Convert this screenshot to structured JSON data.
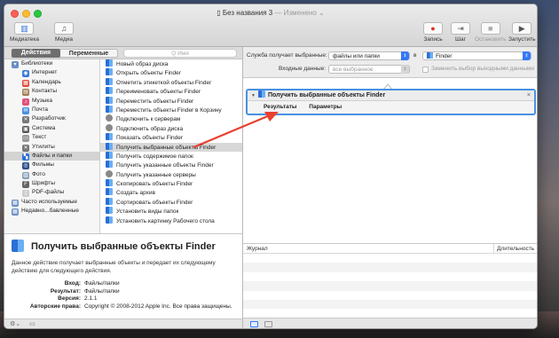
{
  "window": {
    "title": "Без названия 3",
    "title_suffix": " — Изменено ⌄"
  },
  "toolbar": {
    "left": [
      {
        "label": "Медиатека",
        "icon": "library-icon"
      },
      {
        "label": "Медиа",
        "icon": "media-icon"
      }
    ],
    "right": [
      {
        "label": "Запись",
        "icon": "record-icon"
      },
      {
        "label": "Шаг",
        "icon": "step-icon"
      },
      {
        "label": "Остановить",
        "icon": "stop-icon"
      },
      {
        "label": "Запустить",
        "icon": "play-icon"
      }
    ]
  },
  "library": {
    "tab_actions": "Действия",
    "tab_variables": "Переменные",
    "search_placeholder": "Q Имя",
    "categories": [
      {
        "label": "Библиотеки",
        "sub": false,
        "color": "#6a8fc4",
        "glyph": "▾"
      },
      {
        "label": "Интернет",
        "sub": true,
        "color": "#3a7bd5",
        "glyph": "◉"
      },
      {
        "label": "Календарь",
        "sub": true,
        "color": "#e04b3a",
        "glyph": "▦"
      },
      {
        "label": "Контакты",
        "sub": true,
        "color": "#a07a50",
        "glyph": "▤"
      },
      {
        "label": "Музыка",
        "sub": true,
        "color": "#e3507a",
        "glyph": "♪"
      },
      {
        "label": "Почта",
        "sub": true,
        "color": "#4a90e2",
        "glyph": "✉"
      },
      {
        "label": "Разработчик",
        "sub": true,
        "color": "#777",
        "glyph": "✕"
      },
      {
        "label": "Система",
        "sub": true,
        "color": "#555",
        "glyph": "▣"
      },
      {
        "label": "Текст",
        "sub": true,
        "color": "#999",
        "glyph": "▭"
      },
      {
        "label": "Утилиты",
        "sub": true,
        "color": "#777",
        "glyph": "✕"
      },
      {
        "label": "Файлы и папки",
        "sub": true,
        "color": "#2a6fd6",
        "glyph": "▚",
        "selected": true
      },
      {
        "label": "Фильмы",
        "sub": true,
        "color": "#2d4f8a",
        "glyph": "◎"
      },
      {
        "label": "Фото",
        "sub": true,
        "color": "#8a9fb8",
        "glyph": "▧"
      },
      {
        "label": "Шрифты",
        "sub": true,
        "color": "#666",
        "glyph": "F"
      },
      {
        "label": "PDF-файлы",
        "sub": true,
        "color": "#ccc",
        "glyph": "▯"
      },
      {
        "label": "Часто используемые",
        "sub": false,
        "color": "#6a8fc4",
        "glyph": "▦"
      },
      {
        "label": "Недавно...бавленные",
        "sub": false,
        "color": "#6a8fc4",
        "glyph": "▦"
      }
    ],
    "actions": [
      {
        "label": "Новый образ диска",
        "icon": "finder"
      },
      {
        "label": "Открыть объекты Finder",
        "icon": "finder"
      },
      {
        "label": "Отметить этикеткой объекты Finder",
        "icon": "finder"
      },
      {
        "label": "Переименовать объекты Finder",
        "icon": "finder"
      },
      {
        "label": "Переместить объекты Finder",
        "icon": "finder"
      },
      {
        "label": "Переместить объекты Finder в Корзину",
        "icon": "finder"
      },
      {
        "label": "Подключить к серверам",
        "icon": "gear"
      },
      {
        "label": "Подключить образ диска",
        "icon": "gear"
      },
      {
        "label": "Показать объекты Finder",
        "icon": "finder"
      },
      {
        "label": "Получить выбранные объекты Finder",
        "icon": "finder",
        "selected": true
      },
      {
        "label": "Получить содержимое папок",
        "icon": "finder"
      },
      {
        "label": "Получить указанные объекты Finder",
        "icon": "finder"
      },
      {
        "label": "Получить указанные серверы",
        "icon": "gear"
      },
      {
        "label": "Скопировать объекты Finder",
        "icon": "finder"
      },
      {
        "label": "Создать архив",
        "icon": "finder"
      },
      {
        "label": "Сортировать объекты Finder",
        "icon": "finder"
      },
      {
        "label": "Установить виды папок",
        "icon": "finder"
      },
      {
        "label": "Установить картинку Рабочего стола",
        "icon": "finder"
      }
    ]
  },
  "description": {
    "title": "Получить выбранные объекты Finder",
    "text": "Данное действие получает выбранные объекты и передает их следующему действию для следующего действия.",
    "rows": [
      {
        "key": "Вход:",
        "value": "Файлы/папки"
      },
      {
        "key": "Результат:",
        "value": "Файлы/папки"
      },
      {
        "key": "Версия:",
        "value": "2.1.1"
      },
      {
        "key": "Авторские права:",
        "value": "Copyright © 2008-2012 Apple Inc. Все права защищены."
      }
    ]
  },
  "workflow": {
    "receives_label": "Служба получает выбранные:",
    "receives_value": "файлы или папки",
    "in_label": "в",
    "app_value": "Finder",
    "input_label": "Входные данные:",
    "input_value": "все выбранное",
    "replace_label": "Заменить выбор выходными данными",
    "card": {
      "title": "Получить выбранные объекты Finder",
      "close": "×",
      "tab_results": "Результаты",
      "tab_params": "Параметры"
    }
  },
  "log": {
    "col_log": "Журнал",
    "col_duration": "Длительность"
  },
  "colors": {
    "accent": "#3478f6",
    "arrow": "#e8412f"
  }
}
